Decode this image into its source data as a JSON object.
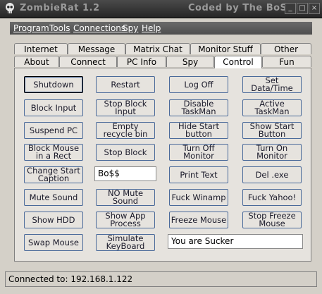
{
  "window": {
    "title": "ZombieRat 1.2",
    "credit": "Coded by The BoSS"
  },
  "menu": [
    "Program",
    "Tools",
    "Connections",
    "Spy",
    "Help"
  ],
  "tabs_row_back": [
    "Internet",
    "Message",
    "Matrix Chat",
    "Monitor Stuff",
    "Other"
  ],
  "tabs_row_front": [
    "About",
    "Connect",
    "PC Info",
    "Spy",
    "Control",
    "Fun"
  ],
  "active_tab": "Control",
  "buttons": [
    [
      "Shutdown",
      "Restart",
      "Log Off",
      "Set Data/Time"
    ],
    [
      "Block Input",
      "Stop Block Input",
      "Disable TaskMan",
      "Active TaskMan"
    ],
    [
      "Suspend PC",
      "Empty recycle bin",
      "Hide Start button",
      "Show Start Button"
    ],
    [
      "Block Mouse in a Rect",
      "Stop Block",
      "Turn Off Monitor",
      "Turn On Monitor"
    ],
    [
      "Change Start Caption",
      "",
      "Print Text",
      "Del .exe"
    ],
    [
      "Mute Sound",
      "NO Mute Sound",
      "Fuck Winamp",
      "Fuck Yahoo!"
    ],
    [
      "Show HDD",
      "Show App Process",
      "Freeze Mouse",
      "Stop Freeze Mouse"
    ],
    [
      "Swap Mouse",
      "Simulate KeyBoard",
      "",
      ""
    ]
  ],
  "caption_input_value": "Bo$$",
  "message_input_value": "You are Sucker",
  "status": "Connected to: 192.168.1.122",
  "colors": {
    "titlebar": "#2e2e2e",
    "menubar": "#5a5a5a",
    "button_border": "#4a6a9a"
  }
}
